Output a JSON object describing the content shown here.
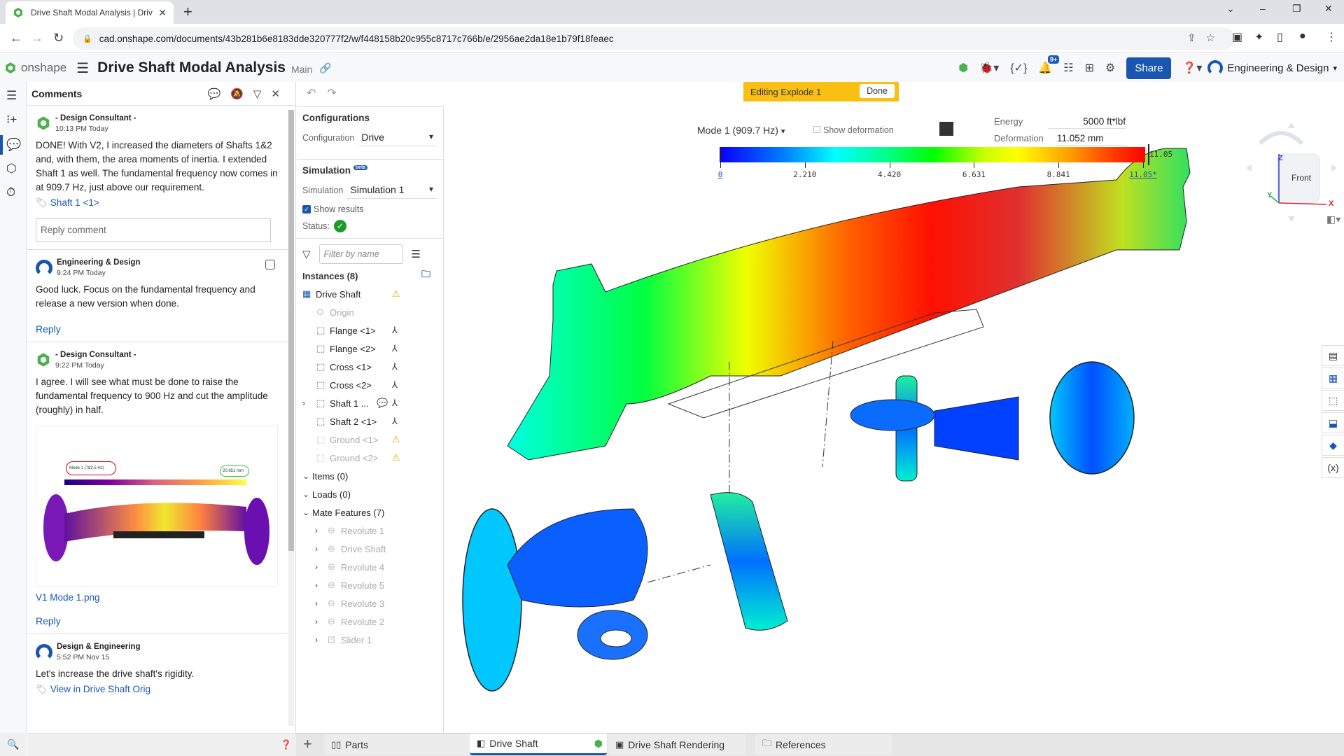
{
  "browser": {
    "tab_title": "Drive Shaft Modal Analysis | Driv",
    "url": "cad.onshape.com/documents/43b281b6e8183dde320777f2/w/f448158b20c955c8717c766b/e/2956ae2da18e1b79f18feaec"
  },
  "header": {
    "logo_text": "onshape",
    "doc_title": "Drive Shaft Modal Analysis",
    "branch": "Main",
    "notifications_badge": "9+",
    "share_label": "Share",
    "user_name": "Engineering & Design"
  },
  "comments": {
    "title": "Comments",
    "items": [
      {
        "author": "- Design Consultant -",
        "time": "10:13 PM Today",
        "text": "DONE!  With V2, I increased the diameters of Shafts 1&2 and, with them, the area moments of inertia.  I extended Shaft 1 as well.  The fundamental frequency now comes in at 909.7 Hz, just above our requirement.",
        "tag": "Shaft 1 <1>",
        "reply_placeholder": "Reply comment"
      },
      {
        "author": "Engineering & Design",
        "time": "9:24 PM Today",
        "text": "Good luck.  Focus on the fundamental frequency and release a new version when done.",
        "reply": "Reply"
      },
      {
        "author": "- Design Consultant -",
        "time": "9:22 PM Today",
        "text": "I agree.  I will see what must be done to raise the fundamental frequency to 900 Hz and cut the amplitude (roughly) in half.",
        "attachment": "V1 Mode 1.png",
        "attachment_mode": "Mode 1 (782.5 Hz)",
        "attachment_deformation": "20.651 mm",
        "reply": "Reply"
      },
      {
        "author": "Design & Engineering",
        "time": "5:52 PM Nov 15",
        "text": "Let's increase the drive shaft's rigidity.",
        "tag": "View in Drive Shaft Orig"
      }
    ]
  },
  "features": {
    "configurations_title": "Configurations",
    "configuration_label": "Configuration",
    "configuration_value": "Drive",
    "simulation_title": "Simulation",
    "beta": "beta",
    "simulation_label": "Simulation",
    "simulation_value": "Simulation 1",
    "show_results": "Show results",
    "status_label": "Status:",
    "filter_placeholder": "Filter by name",
    "instances_title": "Instances (8)",
    "instances": [
      {
        "name": "Drive Shaft",
        "dim": false
      },
      {
        "name": "Origin",
        "dim": true
      },
      {
        "name": "Flange <1>",
        "dim": false
      },
      {
        "name": "Flange <2>",
        "dim": false
      },
      {
        "name": "Cross <1>",
        "dim": false
      },
      {
        "name": "Cross <2>",
        "dim": false
      },
      {
        "name": "Shaft 1 ...",
        "dim": false
      },
      {
        "name": "Shaft 2 <1>",
        "dim": false
      },
      {
        "name": "Ground <1>",
        "dim": true
      },
      {
        "name": "Ground <2>",
        "dim": true
      }
    ],
    "items_title": "Items (0)",
    "loads_title": "Loads (0)",
    "mates_title": "Mate Features (7)",
    "mates": [
      "Revolute 1",
      "Drive Shaft",
      "Revolute 4",
      "Revolute 5",
      "Revolute 3",
      "Revolute 2",
      "Slider 1"
    ]
  },
  "viewport": {
    "explode_label": "Editing Explode 1",
    "done_label": "Done",
    "mode": "Mode 1 (909.7 Hz)",
    "show_deformation": "Show deformation",
    "energy_label": "Energy",
    "energy_value": "5000 ft*lbf",
    "deformation_label": "Deformation",
    "deformation_value": "11.052 mm",
    "colorbar_max": "11.05",
    "colorbar_ticks": [
      "0",
      "2.210",
      "4.420",
      "6.631",
      "8.841",
      "11.05*"
    ],
    "navcube_face": "Front",
    "axis_x": "X",
    "axis_y": "Y",
    "axis_z": "Z"
  },
  "bottom_tabs": [
    {
      "label": "Parts"
    },
    {
      "label": "Drive Shaft",
      "active": true
    },
    {
      "label": "Drive Shaft Rendering"
    },
    {
      "label": "References"
    }
  ]
}
